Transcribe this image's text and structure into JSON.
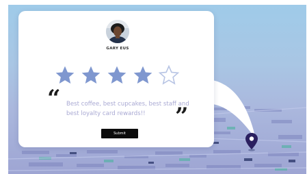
{
  "review_card": {
    "user_name": "GARY EUS",
    "rating": 4,
    "max_rating": 5,
    "review_text": "Best coffee, best cupcakes, best staff and best loyalty card rewards!!",
    "submit_label": "Submit"
  },
  "colors": {
    "star_filled": "#7f97cf",
    "star_empty_outline": "#b7c4e4",
    "quote_text": "#a9a9d3",
    "pin": "#2b2060",
    "submit_bg": "#0c0c0c"
  },
  "icons": {
    "location_pin": "map-pin-icon",
    "avatar": "user-avatar"
  }
}
